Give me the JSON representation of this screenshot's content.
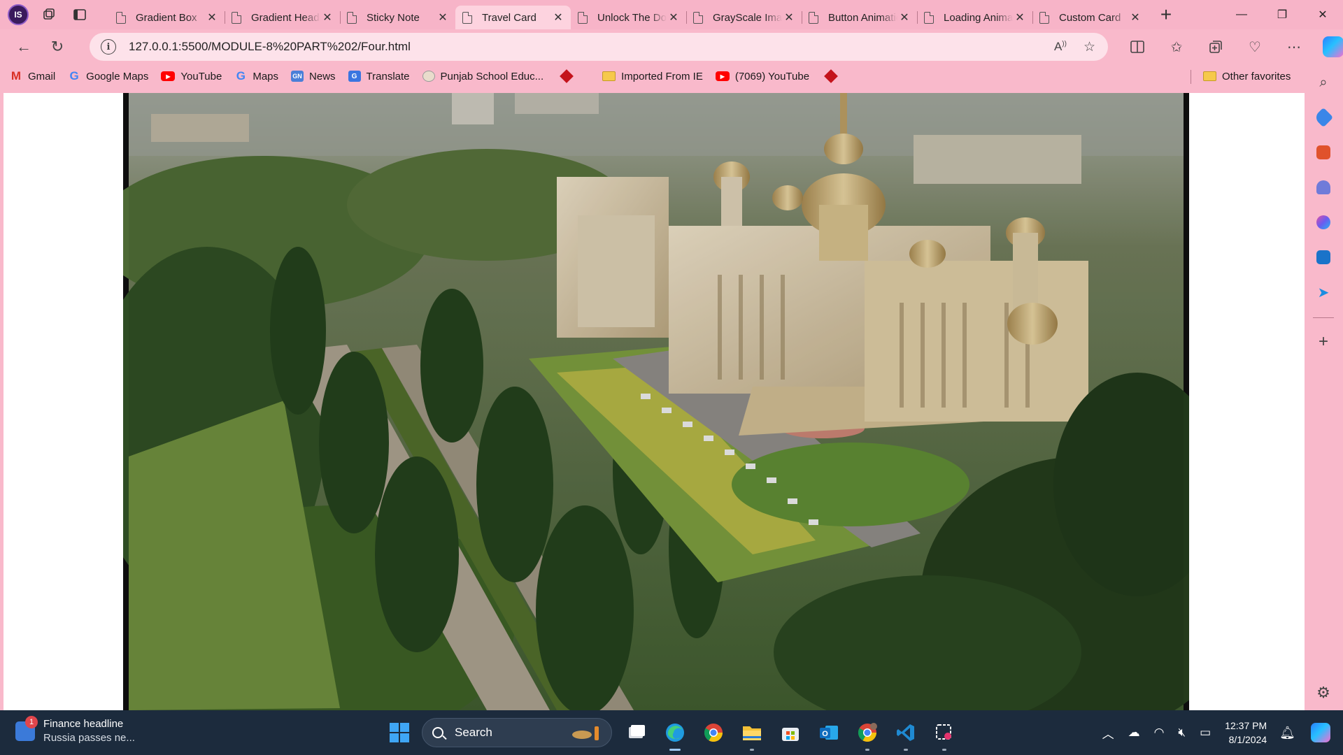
{
  "browser": {
    "profile_initials": "IS",
    "tabs": [
      {
        "title": "Gradient Box",
        "active": false
      },
      {
        "title": "Gradient Heading",
        "active": false
      },
      {
        "title": "Sticky Note",
        "active": false
      },
      {
        "title": "Travel Card",
        "active": true
      },
      {
        "title": "Unlock The Door",
        "active": false
      },
      {
        "title": "GrayScale Image",
        "active": false
      },
      {
        "title": "Button Animation",
        "active": false
      },
      {
        "title": "Loading Animation",
        "active": false
      },
      {
        "title": "Custom Card",
        "active": false
      }
    ],
    "address": {
      "url": "127.0.0.1:5500/MODULE-8%20PART%202/Four.html"
    },
    "favorites": [
      {
        "label": "Gmail",
        "icon": "gmail-icon"
      },
      {
        "label": "Google Maps",
        "icon": "google-icon"
      },
      {
        "label": "YouTube",
        "icon": "youtube-icon"
      },
      {
        "label": "Maps",
        "icon": "google-icon"
      },
      {
        "label": "News",
        "icon": "news-icon"
      },
      {
        "label": "Translate",
        "icon": "translate-icon"
      },
      {
        "label": "Punjab School Educ...",
        "icon": "seal-icon"
      },
      {
        "label": "",
        "icon": "red-diamond-icon"
      },
      {
        "label": "Imported From IE",
        "icon": "folder-icon"
      },
      {
        "label": "(7069) YouTube",
        "icon": "youtube-icon"
      },
      {
        "label": "",
        "icon": "red-diamond-icon"
      }
    ],
    "other_favorites": "Other favorites"
  },
  "taskbar": {
    "widget_badge": "1",
    "widget_title": "Finance headline",
    "widget_subtitle": "Russia passes ne...",
    "search_label": "Search",
    "time": "12:37 PM",
    "date": "8/1/2024"
  },
  "colors": {
    "browser_frame": "#f7b4c8",
    "address_bar": "#fde2ea",
    "taskbar": "#1c2b3d"
  }
}
